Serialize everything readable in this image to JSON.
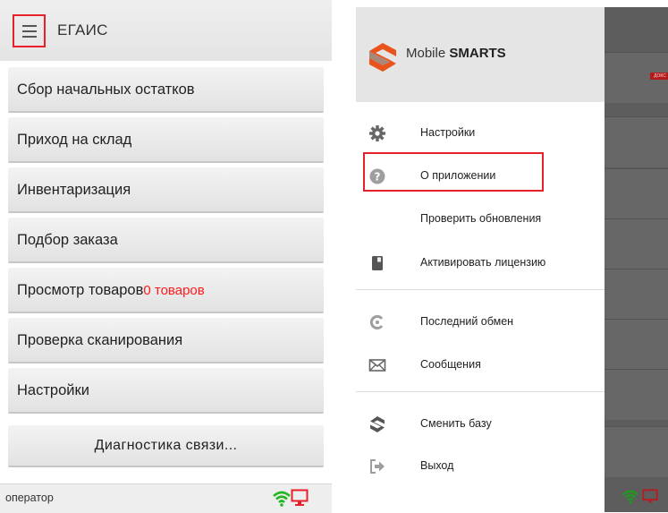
{
  "left_screen": {
    "header": {
      "title": "ЕГАИС"
    },
    "menu": [
      {
        "label": "Сбор начальных остатков"
      },
      {
        "label": "Приход на склад"
      },
      {
        "label": "Инвентаризация"
      },
      {
        "label": "Подбор заказа"
      },
      {
        "label": "Просмотр товаров",
        "badge": "0 товаров"
      },
      {
        "label": "Проверка сканирования"
      },
      {
        "label": "Настройки"
      }
    ],
    "diagnostics_label": "Диагностика связи...",
    "status": {
      "operator": "оператор",
      "wifi_color": "#22b822",
      "monitor_color": "#e8202a"
    },
    "highlight_color": "#e8202a"
  },
  "right_screen": {
    "brand": {
      "name_regular": "Mobile ",
      "name_bold": "SMARTS"
    },
    "drawer_items": [
      {
        "label": "Настройки",
        "icon": "gear-icon"
      },
      {
        "label": "О приложении",
        "icon": "question-icon",
        "highlighted": true
      },
      {
        "label": "Проверить обновления",
        "icon": ""
      },
      {
        "label": "Активировать лицензию",
        "icon": "license-icon"
      },
      {
        "label": "Последний обмен",
        "icon": "exchange-icon"
      },
      {
        "label": "Сообщения",
        "icon": "envelope-icon"
      },
      {
        "label": "Сменить базу",
        "icon": "switch-base-icon"
      },
      {
        "label": "Выход",
        "icon": "exit-icon"
      }
    ],
    "overlay_badge": "ДОКС"
  }
}
